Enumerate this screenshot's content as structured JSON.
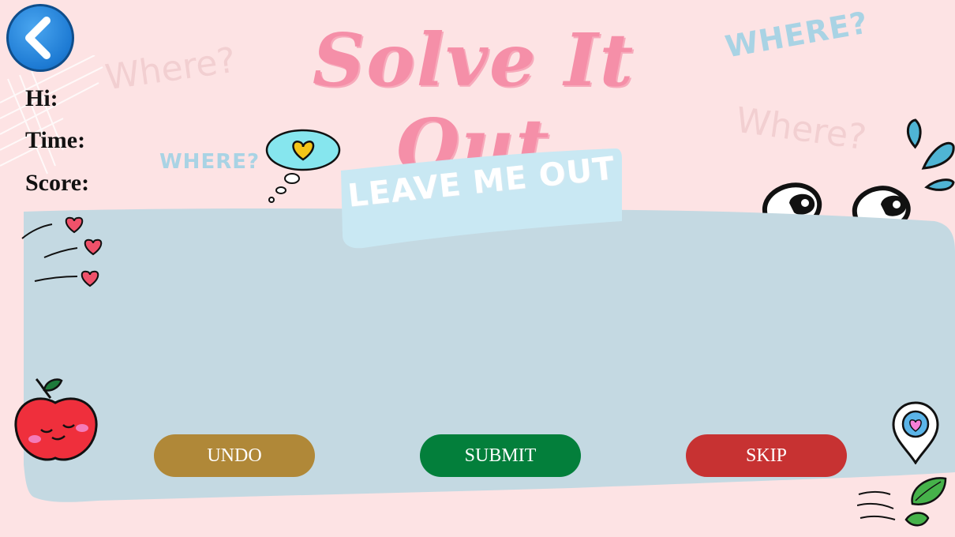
{
  "header": {
    "title": "Solve It Out",
    "back_icon": "chevron-left-icon"
  },
  "stats": {
    "hi_label": "Hi:",
    "time_label": "Time:",
    "score_label": "Score:"
  },
  "decorations": {
    "where_1": "Where?",
    "where_2": "WHERE?",
    "where_3": "Where?",
    "where_4": "WHERE?"
  },
  "board": {
    "tag_text": "LEAVE ME OUT"
  },
  "actions": {
    "undo_label": "UNDO",
    "submit_label": "SUBMIT",
    "skip_label": "SKIP"
  },
  "colors": {
    "background": "#fde3e4",
    "board": "#c4d9e2",
    "title": "#f58fa8",
    "undo": "#b08838",
    "submit": "#037f3b",
    "skip": "#c73232",
    "back_button": "#1d7ad3"
  }
}
